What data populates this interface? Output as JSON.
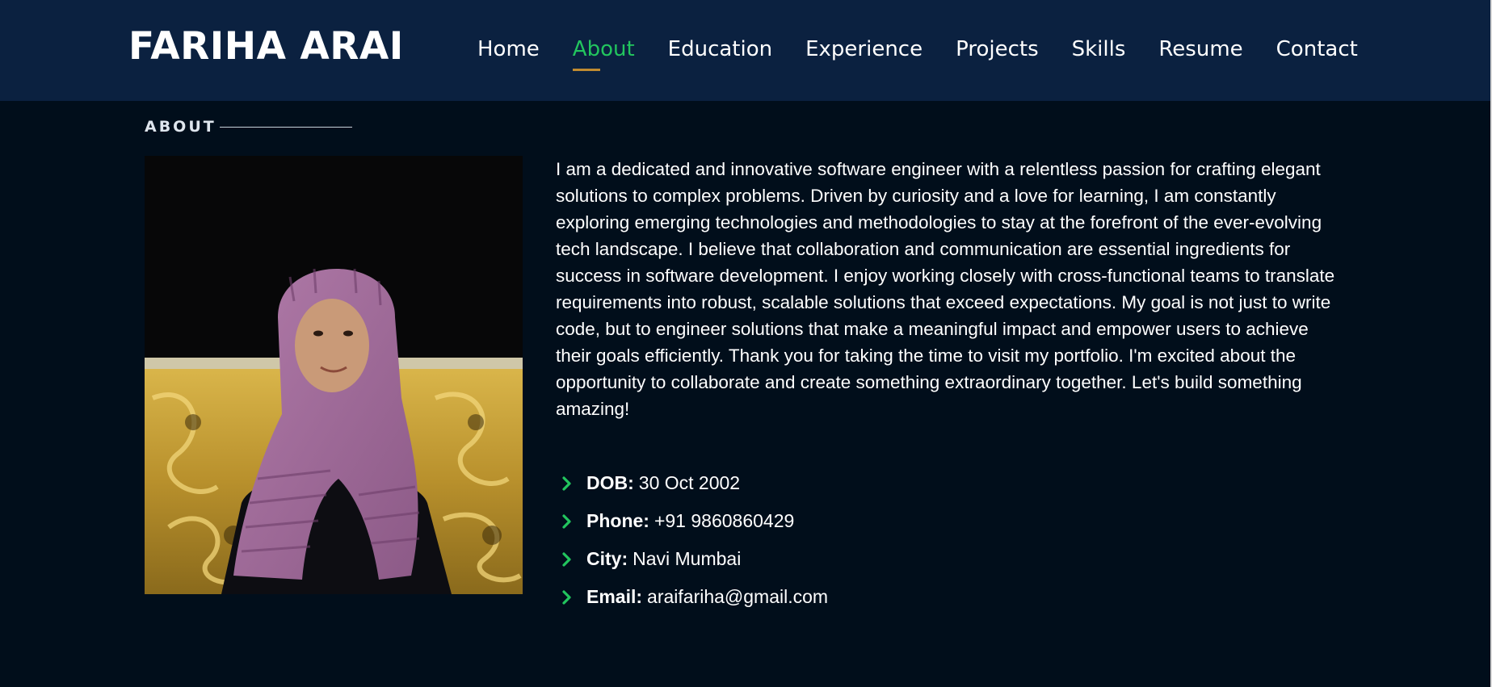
{
  "header": {
    "logo": "FARIHA ARAI",
    "nav": [
      {
        "label": "Home",
        "active": false
      },
      {
        "label": "About",
        "active": true
      },
      {
        "label": "Education",
        "active": false
      },
      {
        "label": "Experience",
        "active": false
      },
      {
        "label": "Projects",
        "active": false
      },
      {
        "label": "Skills",
        "active": false
      },
      {
        "label": "Resume",
        "active": false
      },
      {
        "label": "Contact",
        "active": false
      }
    ]
  },
  "about": {
    "section_title": "ABOUT",
    "bio": "I am a dedicated and innovative software engineer with a relentless passion for crafting elegant solutions to complex problems. Driven by curiosity and a love for learning, I am constantly exploring emerging technologies and methodologies to stay at the forefront of the ever-evolving tech landscape. I believe that collaboration and communication are essential ingredients for success in software development. I enjoy working closely with cross-functional teams to translate requirements into robust, scalable solutions that exceed expectations. My goal is not just to write code, but to engineer solutions that make a meaningful impact and empower users to achieve their goals efficiently. Thank you for taking the time to visit my portfolio. I'm excited about the opportunity to collaborate and create something extraordinary together. Let's build something amazing!",
    "details": [
      {
        "label": "DOB:",
        "value": "30 Oct 2002",
        "icon": "chevron-right-icon"
      },
      {
        "label": "Phone:",
        "value": "+91 9860860429",
        "icon": "chevron-right-icon"
      },
      {
        "label": "City:",
        "value": "Navi Mumbai",
        "icon": "chevron-right-icon"
      },
      {
        "label": "Email:",
        "value": "araifariha@gmail.com",
        "icon": "chevron-right-icon"
      }
    ]
  },
  "colors": {
    "header_bg": "#0b2140",
    "page_bg": "#010e1b",
    "accent_active": "#22c55e",
    "nav_underline": "#c08b31",
    "chevron": "#22c55e"
  }
}
